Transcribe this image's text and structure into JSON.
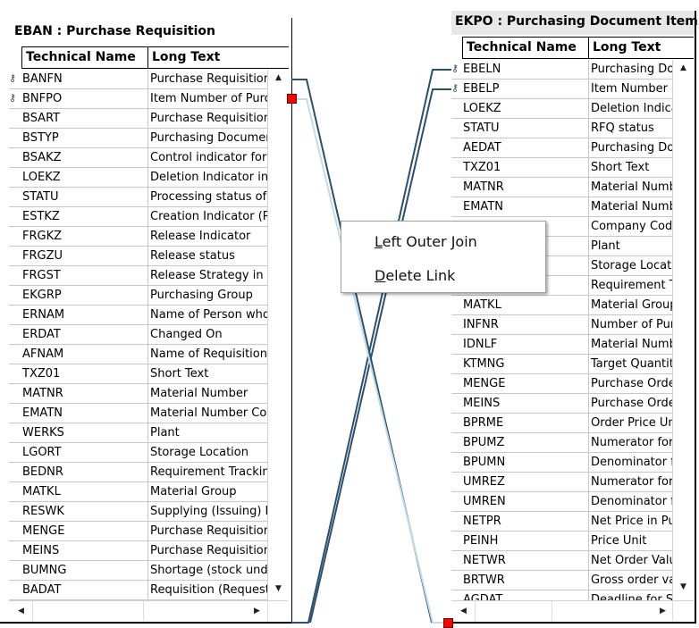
{
  "left_table": {
    "title": "EBAN : Purchase Requisition",
    "columns": [
      "Technical Name",
      "Long Text"
    ],
    "rows": [
      {
        "name": "BANFN",
        "text": "Purchase Requisition N",
        "key": true
      },
      {
        "name": "BNFPO",
        "text": "Item Number of Purcl",
        "key": true
      },
      {
        "name": "BSART",
        "text": "Purchase Requisition D"
      },
      {
        "name": "BSTYP",
        "text": "Purchasing Documen"
      },
      {
        "name": "BSAKZ",
        "text": "Control indicator for p"
      },
      {
        "name": "LOEKZ",
        "text": "Deletion Indicator in P"
      },
      {
        "name": "STATU",
        "text": "Processing status of p"
      },
      {
        "name": "ESTKZ",
        "text": "Creation Indicator (Pu"
      },
      {
        "name": "FRGKZ",
        "text": "Release Indicator"
      },
      {
        "name": "FRGZU",
        "text": "Release status"
      },
      {
        "name": "FRGST",
        "text": "Release Strategy in Pu"
      },
      {
        "name": "EKGRP",
        "text": "Purchasing Group"
      },
      {
        "name": "ERNAM",
        "text": "Name of Person who"
      },
      {
        "name": "ERDAT",
        "text": "Changed On"
      },
      {
        "name": "AFNAM",
        "text": "Name of Requisitioner"
      },
      {
        "name": "TXZ01",
        "text": "Short Text"
      },
      {
        "name": "MATNR",
        "text": "Material Number"
      },
      {
        "name": "EMATN",
        "text": "Material Number Corre"
      },
      {
        "name": "WERKS",
        "text": "Plant"
      },
      {
        "name": "LGORT",
        "text": "Storage Location"
      },
      {
        "name": "BEDNR",
        "text": "Requirement Tracking"
      },
      {
        "name": "MATKL",
        "text": "Material Group"
      },
      {
        "name": "RESWK",
        "text": "Supplying (Issuing) Pl"
      },
      {
        "name": "MENGE",
        "text": "Purchase Requisition Q"
      },
      {
        "name": "MEINS",
        "text": "Purchase Requisition U"
      },
      {
        "name": "BUMNG",
        "text": "Shortage (stock unde"
      },
      {
        "name": "BADAT",
        "text": "Requisition (Request)"
      }
    ]
  },
  "right_table": {
    "title": "EKPO : Purchasing Document Item",
    "columns": [
      "Technical Name",
      "Long Text"
    ],
    "rows": [
      {
        "name": "EBELN",
        "text": "Purchasing Doc",
        "key": true
      },
      {
        "name": "EBELP",
        "text": "Item Number c",
        "key": true
      },
      {
        "name": "LOEKZ",
        "text": "Deletion Indicat"
      },
      {
        "name": "STATU",
        "text": "RFQ status"
      },
      {
        "name": "AEDAT",
        "text": "Purchasing Doc"
      },
      {
        "name": "TXZ01",
        "text": "Short Text"
      },
      {
        "name": "MATNR",
        "text": "Material Numbe"
      },
      {
        "name": "EMATN",
        "text": "Material Numbe"
      },
      {
        "name": "",
        "text": "Company Code"
      },
      {
        "name": "",
        "text": "Plant"
      },
      {
        "name": "",
        "text": "Storage Locatio"
      },
      {
        "name": "",
        "text": "Requirement T"
      },
      {
        "name": "MATKL",
        "text": "Material Group"
      },
      {
        "name": "INFNR",
        "text": "Number of Pur"
      },
      {
        "name": "IDNLF",
        "text": "Material Numbe"
      },
      {
        "name": "KTMNG",
        "text": "Target Quantity"
      },
      {
        "name": "MENGE",
        "text": "Purchase Orde"
      },
      {
        "name": "MEINS",
        "text": "Purchase Orde"
      },
      {
        "name": "BPRME",
        "text": "Order Price Uni"
      },
      {
        "name": "BPUMZ",
        "text": "Numerator for"
      },
      {
        "name": "BPUMN",
        "text": "Denominator fo"
      },
      {
        "name": "UMREZ",
        "text": "Numerator for"
      },
      {
        "name": "UMREN",
        "text": "Denominator fo"
      },
      {
        "name": "NETPR",
        "text": "Net Price in Pur"
      },
      {
        "name": "PEINH",
        "text": "Price Unit"
      },
      {
        "name": "NETWR",
        "text": "Net Order Valu"
      },
      {
        "name": "BRTWR",
        "text": "Gross order val"
      },
      {
        "name": "AGDAT",
        "text": "Deadline for Su"
      }
    ]
  },
  "context_menu": {
    "items": [
      {
        "label": "Left Outer Join",
        "mnemonic": "L",
        "rest": "eft Outer Join"
      },
      {
        "label": "Delete Link",
        "mnemonic": "D",
        "rest": "elete Link"
      }
    ]
  },
  "colors": {
    "link_dark": "#2b4f6e",
    "link_selected": "#c5dce8",
    "handle": "#ff0000",
    "title_bg": "#e8e8e8"
  }
}
